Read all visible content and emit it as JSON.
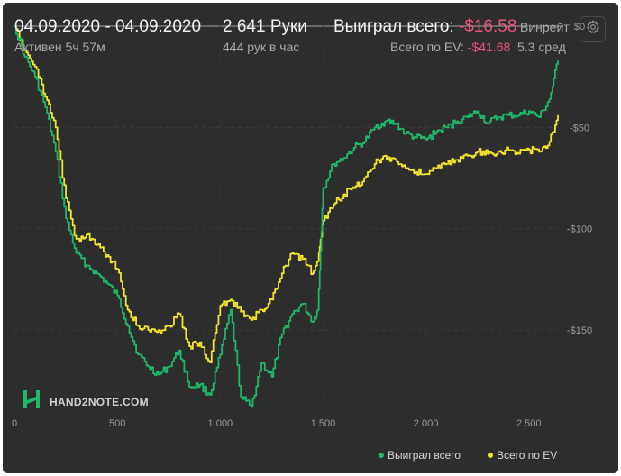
{
  "header": {
    "date_range": "04.09.2020 - 04.09.2020",
    "active_time": "Активен 5ч 57м",
    "hands_count": "2 641 Руки",
    "hands_rate": "444 рук в час",
    "won_label": "Выиграл всего:",
    "won_value": "-$16.58",
    "ev_label": "Всего по EV:",
    "ev_value": "-$41.68",
    "winrate_label": "Винрейт",
    "winrate_value": "5.3 сред"
  },
  "brand": {
    "text": "HAND2NOTE.COM"
  },
  "colors": {
    "won": "#1db86a",
    "ev": "#f2e52a",
    "negative": "#e9557a",
    "background": "#2d2d2d"
  },
  "icons": {
    "settings": "gear-icon",
    "logo": "hand2note-logo-icon"
  },
  "chart_data": {
    "type": "line",
    "x_ticks": [
      0,
      500,
      1000,
      1500,
      2000,
      2500
    ],
    "x_tick_labels": [
      "0",
      "500",
      "1 000",
      "1 500",
      "2 000",
      "2 500"
    ],
    "y_ticks": [
      0,
      -50,
      -100,
      -150
    ],
    "y_tick_labels": [
      "$0",
      "-$50",
      "-$100",
      "-$150"
    ],
    "xlim": [
      0,
      2641
    ],
    "ylim": [
      -190,
      8
    ],
    "legend": "bottom-right",
    "series": [
      {
        "name": "Выиграл всего",
        "color": "#1db86a",
        "x": [
          0,
          50,
          100,
          150,
          200,
          250,
          300,
          350,
          400,
          450,
          500,
          550,
          600,
          650,
          700,
          750,
          800,
          850,
          900,
          950,
          1000,
          1050,
          1100,
          1150,
          1200,
          1250,
          1300,
          1350,
          1400,
          1450,
          1475,
          1500,
          1550,
          1600,
          1650,
          1700,
          1750,
          1800,
          1850,
          1900,
          1950,
          2000,
          2050,
          2100,
          2150,
          2200,
          2250,
          2300,
          2350,
          2400,
          2450,
          2500,
          2550,
          2600,
          2641
        ],
        "y": [
          0,
          -15,
          -25,
          -40,
          -62,
          -95,
          -112,
          -118,
          -122,
          -127,
          -133,
          -148,
          -162,
          -168,
          -172,
          -168,
          -160,
          -178,
          -177,
          -182,
          -162,
          -140,
          -183,
          -188,
          -166,
          -173,
          -152,
          -142,
          -137,
          -146,
          -140,
          -80,
          -68,
          -65,
          -60,
          -57,
          -50,
          -47,
          -48,
          -53,
          -55,
          -56,
          -52,
          -50,
          -47,
          -45,
          -42,
          -48,
          -45,
          -44,
          -44,
          -42,
          -45,
          -36,
          -17
        ]
      },
      {
        "name": "Всего по EV",
        "color": "#f2e52a",
        "x": [
          0,
          50,
          100,
          150,
          200,
          250,
          300,
          350,
          400,
          450,
          500,
          550,
          600,
          650,
          700,
          750,
          800,
          850,
          900,
          950,
          1000,
          1050,
          1100,
          1150,
          1200,
          1250,
          1300,
          1350,
          1400,
          1450,
          1475,
          1500,
          1550,
          1600,
          1650,
          1700,
          1750,
          1800,
          1850,
          1900,
          1950,
          2000,
          2050,
          2100,
          2150,
          2200,
          2250,
          2300,
          2350,
          2400,
          2450,
          2500,
          2550,
          2600,
          2641
        ],
        "y": [
          0,
          -12,
          -20,
          -35,
          -50,
          -85,
          -105,
          -103,
          -108,
          -113,
          -120,
          -140,
          -148,
          -150,
          -150,
          -148,
          -142,
          -158,
          -156,
          -166,
          -138,
          -135,
          -141,
          -145,
          -140,
          -135,
          -122,
          -112,
          -115,
          -122,
          -116,
          -96,
          -88,
          -83,
          -80,
          -75,
          -68,
          -64,
          -66,
          -70,
          -72,
          -73,
          -70,
          -68,
          -66,
          -64,
          -62,
          -63,
          -62,
          -61,
          -63,
          -61,
          -62,
          -57,
          -44
        ]
      }
    ]
  }
}
